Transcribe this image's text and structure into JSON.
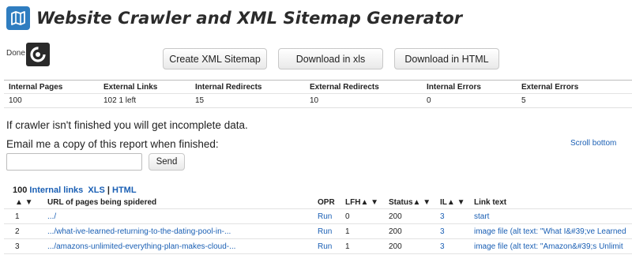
{
  "app": {
    "title": "Website Crawler and XML Sitemap Generator",
    "icon": "map-icon",
    "accent": "#2f7dc0"
  },
  "status": {
    "label": "Done",
    "icon": "spinner-icon"
  },
  "toolbar": {
    "create_sitemap": "Create XML Sitemap",
    "download_xls": "Download in xls",
    "download_html": "Download in HTML"
  },
  "stats": {
    "headers": [
      "Internal Pages",
      "External Links",
      "Internal Redirects",
      "External Redirects",
      "Internal Errors",
      "External Errors"
    ],
    "values": [
      "100",
      "102 1 left",
      "15",
      "10",
      "0",
      "5"
    ]
  },
  "notice": "If crawler isn't finished you will get incomplete data.",
  "email": {
    "label": "Email me a copy of this report when finished:",
    "value": "",
    "placeholder": "",
    "send_label": "Send"
  },
  "scroll_bottom": "Scroll bottom",
  "links_bar": {
    "count": "100",
    "internal_links": "Internal links",
    "xls": "XLS",
    "separator": "|",
    "html": "HTML"
  },
  "table": {
    "sort_label": "▲ ▼",
    "headers": {
      "url": "URL of pages being spidered",
      "opr": "OPR",
      "lfh": "LFH▲ ▼",
      "status": "Status▲ ▼",
      "il": "IL▲ ▼",
      "link_text": "Link text"
    },
    "rows": [
      {
        "num": "1",
        "url": ".../",
        "opr": "Run",
        "lfh": "0",
        "status": "200",
        "il": "3",
        "text": "start"
      },
      {
        "num": "2",
        "url": ".../what-ive-learned-returning-to-the-dating-pool-in-...",
        "opr": "Run",
        "lfh": "1",
        "status": "200",
        "il": "3",
        "text": "image file (alt text: \"What I&#39;ve Learned"
      },
      {
        "num": "3",
        "url": ".../amazons-unlimited-everything-plan-makes-cloud-...",
        "opr": "Run",
        "lfh": "1",
        "status": "200",
        "il": "3",
        "text": "image file (alt text: \"Amazon&#39;s Unlimit"
      }
    ]
  }
}
